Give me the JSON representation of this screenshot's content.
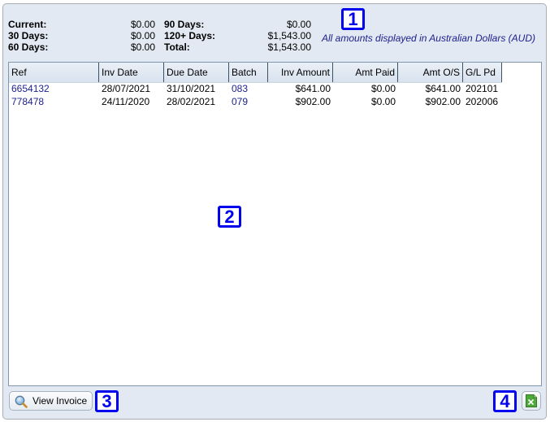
{
  "summary": {
    "left": [
      {
        "label": "Current:",
        "value": "$0.00"
      },
      {
        "label": "30 Days:",
        "value": "$0.00"
      },
      {
        "label": "60 Days:",
        "value": "$0.00"
      }
    ],
    "right": [
      {
        "label": "90 Days:",
        "value": "$0.00"
      },
      {
        "label": "120+ Days:",
        "value": "$1,543.00"
      },
      {
        "label": "Total:",
        "value": "$1,543.00"
      }
    ],
    "currency_note": "All amounts displayed in Australian Dollars (AUD)"
  },
  "table": {
    "columns": [
      "Ref",
      "Inv Date",
      "Due Date",
      "Batch",
      "Inv Amount",
      "Amt Paid",
      "Amt O/S",
      "G/L Pd"
    ],
    "rows": [
      [
        "6654132",
        "28/07/2021",
        "31/10/2021",
        "083",
        "$641.00",
        "$0.00",
        "$641.00",
        "202101"
      ],
      [
        "778478",
        "24/11/2020",
        "28/02/2021",
        "079",
        "$902.00",
        "$0.00",
        "$902.00",
        "202006"
      ]
    ]
  },
  "buttons": {
    "view_invoice": "View Invoice",
    "export_icon": "excel-export-icon"
  },
  "markers": [
    "1",
    "2",
    "3",
    "4"
  ],
  "colors": {
    "panel_bg": "#e2e9f2",
    "link": "#1a1f8c",
    "marker": "#0000ee"
  }
}
